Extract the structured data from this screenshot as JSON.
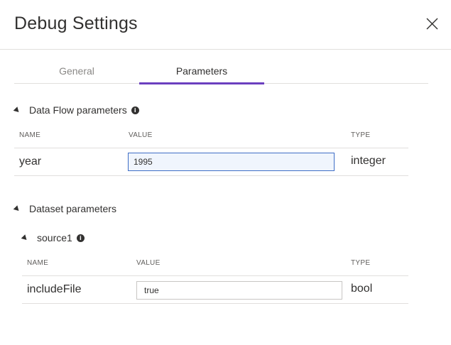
{
  "dialog": {
    "title": "Debug Settings",
    "close_icon": "close-icon"
  },
  "tabs": [
    {
      "label": "General",
      "selected": false
    },
    {
      "label": "Parameters",
      "selected": true
    }
  ],
  "dataflow_section": {
    "title": "Data Flow parameters",
    "columns": {
      "name": "NAME",
      "value": "VALUE",
      "type": "TYPE"
    },
    "rows": [
      {
        "name": "year",
        "value": "1995",
        "type": "integer"
      }
    ]
  },
  "dataset_section": {
    "title": "Dataset parameters",
    "sources": [
      {
        "name": "source1",
        "columns": {
          "name": "NAME",
          "value": "VALUE",
          "type": "TYPE"
        },
        "rows": [
          {
            "name": "includeFile",
            "value": "true",
            "type": "bool"
          }
        ]
      }
    ]
  },
  "colors": {
    "accent": "#6b3fbf",
    "focus_border": "#3f6ec6",
    "divider": "#e1dfdd"
  }
}
